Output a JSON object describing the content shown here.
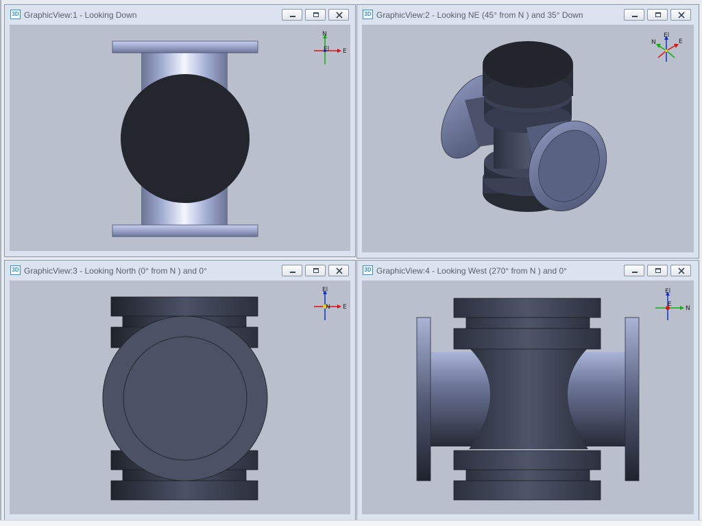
{
  "views": [
    {
      "id": 1,
      "title": "GraphicView:1 - Looking Down",
      "icon": "3D",
      "triad": {
        "labels": [
          "N",
          "El",
          "E"
        ]
      }
    },
    {
      "id": 2,
      "title": "GraphicView:2 - Looking NE (45° from N ) and 35° Down",
      "icon": "3D",
      "triad": {
        "labels": [
          "El",
          "N",
          "E"
        ]
      }
    },
    {
      "id": 3,
      "title": "GraphicView:3 - Looking North (0° from N ) and 0°",
      "icon": "3D",
      "triad": {
        "labels": [
          "El",
          "N",
          "E"
        ]
      }
    },
    {
      "id": 4,
      "title": "GraphicView:4 - Looking West (270° from N ) and 0°",
      "icon": "3D",
      "triad": {
        "labels": [
          "El",
          "E",
          "N"
        ]
      }
    }
  ],
  "window_controls": [
    "minimize",
    "maximize",
    "close"
  ],
  "colors": {
    "viewport_bg": "#b9c0cc",
    "titlebar_bg": "#dbe4ee",
    "dark_face": "#23262c",
    "steel_dark": "#3f4656",
    "steel_light": "#aab4d6",
    "triad_x": "#e01010",
    "triad_y": "#10b010",
    "triad_z": "#1030d0"
  }
}
